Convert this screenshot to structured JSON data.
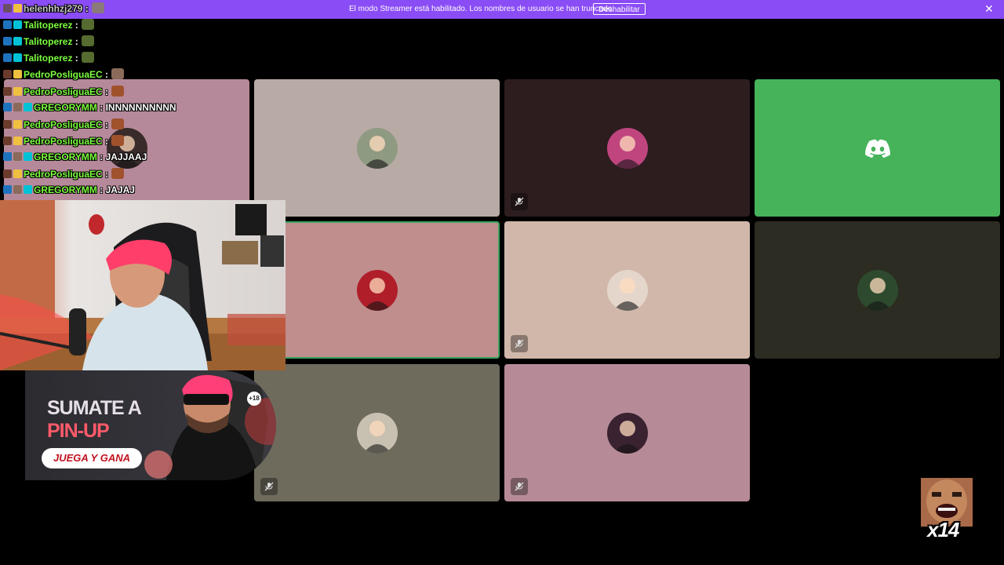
{
  "banner": {
    "message": "El modo Streamer está habilitado. Los nombres de usuario se han truncado.",
    "button_label": "Deshabilitar",
    "close_glyph": "✕"
  },
  "chat": [
    {
      "user": "helenhhzj279",
      "text": "",
      "color": "#c7c7c7"
    },
    {
      "user": "Talitoperez",
      "text": "",
      "color": "#7cff3e"
    },
    {
      "user": "Talitoperez",
      "text": "",
      "color": "#7cff3e"
    },
    {
      "user": "Talitoperez",
      "text": "",
      "color": "#7cff3e"
    },
    {
      "user": "PedroPosliguaEC",
      "text": "",
      "color": "#7cff3e"
    },
    {
      "user": "PedroPosliguaEC",
      "text": "",
      "color": "#7cff3e"
    },
    {
      "user": "GREGORYMM",
      "text": "INNNNNNNNNN",
      "color": "#7cff3e"
    },
    {
      "user": "PedroPosliguaEC",
      "text": "",
      "color": "#7cff3e"
    },
    {
      "user": "PedroPosliguaEC",
      "text": "",
      "color": "#7cff3e"
    },
    {
      "user": "GREGORYMM",
      "text": "JAJJAAJ",
      "color": "#7cff3e"
    },
    {
      "user": "PedroPosliguaEC",
      "text": "",
      "color": "#7cff3e"
    },
    {
      "user": "GREGORYMM",
      "text": "JAJAJ",
      "color": "#7cff3e"
    }
  ],
  "separator": " :",
  "tiles": [
    {
      "bg": "#b6899a",
      "muted": false,
      "speaking": false
    },
    {
      "bg": "#b8aaa5",
      "muted": false,
      "speaking": false
    },
    {
      "bg": "#2d1d1f",
      "muted": true,
      "speaking": false
    },
    {
      "bg": "#46b35a",
      "muted": false,
      "speaking": false,
      "discord_logo": true
    },
    {
      "bg": "#bf8e8d",
      "muted": false,
      "speaking": true
    },
    {
      "bg": "#d1b7aa",
      "muted": true,
      "speaking": false
    },
    {
      "bg": "#2c2c22",
      "muted": false,
      "speaking": false
    },
    {
      "bg": "#6e6b5d",
      "muted": true,
      "speaking": false
    },
    {
      "bg": "#b68b97",
      "muted": true,
      "speaking": false
    }
  ],
  "icons": {
    "mute": "mic-off-icon",
    "discord": "discord-logo-icon",
    "close": "close-icon"
  },
  "ad": {
    "title_line1": "SUMATE A",
    "title_line2": "PIN-UP",
    "cta": "JUEGA Y GANA",
    "age": "+18"
  },
  "gif": {
    "count": "x14"
  },
  "colors": {
    "accent": "#8a4cf5",
    "discord_green": "#46b35a"
  }
}
